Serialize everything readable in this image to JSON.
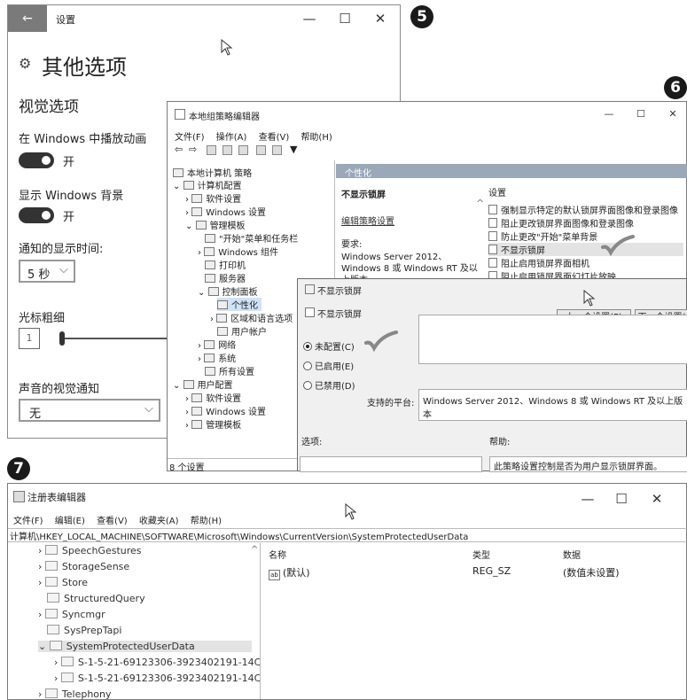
{
  "badges": {
    "five": "5",
    "six": "6",
    "seven": "7"
  },
  "settings_window": {
    "back_arrow": "←",
    "title": "设置",
    "controls": {
      "minimize": "—",
      "maximize": "☐",
      "close": "✕"
    },
    "gear_icon": "⚙",
    "page_title": "其他选项",
    "section_title": "视觉选项",
    "animation_label": "在 Windows 中播放动画",
    "animation_state": "开",
    "background_label": "显示 Windows 背景",
    "background_state": "开",
    "notify_time_label": "通知的显示时间:",
    "notify_time_value": "5 秒",
    "cursor_label": "光标粗细",
    "cursor_value": "1",
    "sound_label": "声音的视觉通知",
    "sound_value": "无",
    "chevron": "⌵"
  },
  "gpedit": {
    "title": "本地组策略编辑器",
    "controls": {
      "minimize": "—",
      "maximize": "☐",
      "close": "✕"
    },
    "menu": [
      "文件(F)",
      "操作(A)",
      "查看(V)",
      "帮助(H)"
    ],
    "tree": [
      "本地计算机 策略",
      "计算机配置",
      "软件设置",
      "Windows 设置",
      "管理模板",
      "\"开始\"菜单和任务栏",
      "Windows 组件",
      "打印机",
      "服务器",
      "控制面板",
      "个性化",
      "区域和语言选项",
      "用户帐户",
      "网络",
      "系统",
      "所有设置",
      "用户配置",
      "软件设置",
      "Windows 设置",
      "管理模板"
    ],
    "header": "个性化",
    "desc_title": "不显示锁屏",
    "edit_link": "编辑策略设置",
    "req_label": "要求:",
    "req_text1": "Windows Server 2012、",
    "req_text2": "Windows 8 或 Windows RT 及以",
    "req_text3": "上版本",
    "settings_header": "设置",
    "policies": [
      "强制显示特定的默认锁屏界面图像和登录图像",
      "阻止更改锁屏界面图像和登录图像",
      "防止更改\"开始\"菜单背景",
      "不显示锁屏",
      "阻止启用锁屏界面相机",
      "阻止启用锁屏界面幻灯片放映"
    ],
    "status": "8 个设置"
  },
  "dialog": {
    "title": "不显示锁屏",
    "setting_name": "不显示锁屏",
    "prev_button": "上一个设置(P)",
    "next_button": "下一个设置(",
    "options": [
      "未配置(C)",
      "已启用(E)",
      "已禁用(D)"
    ],
    "platform_label": "支持的平台:",
    "platform_value": "Windows Server 2012、Windows 8 或 Windows RT 及以上版本",
    "options_label": "选项:",
    "help_label": "帮助:",
    "help_text": "此策略设置控制是否为用户显示锁屏界面。"
  },
  "regedit": {
    "title": "注册表编辑器",
    "controls": {
      "minimize": "—",
      "maximize": "☐",
      "close": "✕"
    },
    "menu": [
      "文件(F)",
      "编辑(E)",
      "查看(V)",
      "收藏夹(A)",
      "帮助(H)"
    ],
    "path": "计算机\\HKEY_LOCAL_MACHINE\\SOFTWARE\\Microsoft\\Windows\\CurrentVersion\\SystemProtectedUserData",
    "tree": [
      "SpeechGestures",
      "StorageSense",
      "Store",
      "StructuredQuery",
      "Syncmgr",
      "SysPrepTapi",
      "SystemProtectedUserData",
      "S-1-5-21-69123306-3923402191-14C",
      "S-1-5-21-69123306-3923402191-14C",
      "Telephony"
    ],
    "columns": {
      "name": "名称",
      "type": "类型",
      "data": "数据"
    },
    "values": [
      {
        "name": "(默认)",
        "type": "REG_SZ",
        "data": "(数值未设置)"
      }
    ]
  }
}
